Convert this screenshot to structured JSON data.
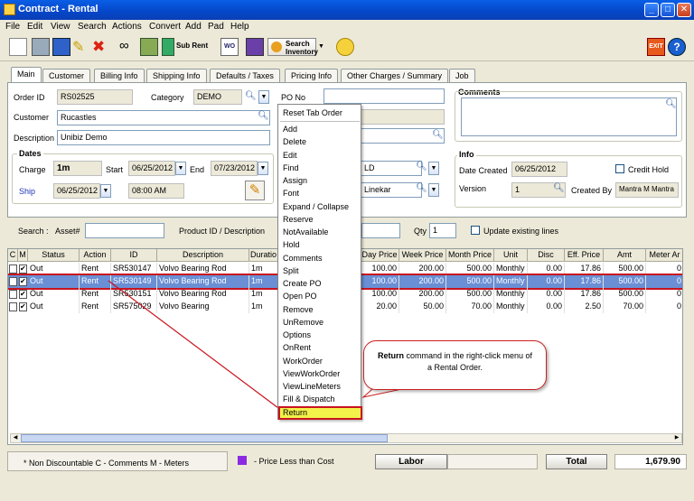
{
  "window": {
    "title": "Contract - Rental"
  },
  "menu": [
    "File",
    "Edit",
    "View",
    "Search",
    "Actions",
    "Convert",
    "Add",
    "Pad",
    "Help"
  ],
  "toolbar": {
    "subrent": "Sub Rent",
    "wo": "WO",
    "search_inv_1": "Search",
    "search_inv_2": "Inventory",
    "exit": "EXIT"
  },
  "tabs": [
    "Main",
    "Customer",
    "Billing Info",
    "Shipping Info",
    "Defaults / Taxes",
    "Pricing Info",
    "Other Charges / Summary",
    "Job"
  ],
  "form": {
    "order_id_label": "Order ID",
    "order_id": "RS02525",
    "category_label": "Category",
    "category": "DEMO",
    "po_no_label": "PO No",
    "customer_label": "Customer",
    "customer": "Rucastles",
    "description_label": "Description",
    "description": "Unibiz Demo",
    "dates_label": "Dates",
    "charge_label": "Charge",
    "charge": "1m",
    "start_label": "Start",
    "start": "06/25/2012",
    "end_label": "End",
    "end": "07/23/2012",
    "ship_label": "Ship",
    "ship_date": "06/25/2012",
    "ship_time": "08:00 AM",
    "field_ld": "LD",
    "field_linekar": "Linekar",
    "comments_label": "Comments",
    "info_label": "Info",
    "date_created_label": "Date Created",
    "date_created": "06/25/2012",
    "credit_hold_label": "Credit Hold",
    "version_label": "Version",
    "version": "1",
    "created_by_label": "Created By",
    "created_by": "Mantra M Mantra"
  },
  "search": {
    "search_label": "Search :",
    "asset_label": "Asset#",
    "product_label": "Product ID / Description",
    "qty_label": "Qty",
    "qty": "1",
    "update_label": "Update existing lines"
  },
  "grid": {
    "headers": [
      "C",
      "M",
      "Status",
      "Action",
      "ID",
      "Description",
      "Duratio",
      "Day Price",
      "Week Price",
      "Month Price",
      "Unit",
      "Disc",
      "Eff. Price",
      "Amt",
      "Meter Ar"
    ],
    "rows": [
      [
        "",
        "✔",
        "Out",
        "Rent",
        "SR530147",
        "Volvo Bearing Rod",
        "1m",
        "100.00",
        "200.00",
        "500.00",
        "Monthly",
        "0.00",
        "17.86",
        "500.00",
        "0"
      ],
      [
        "",
        "✔",
        "Out",
        "Rent",
        "SR530149",
        "Volvo Bearing Rod",
        "1m",
        "100.00",
        "200.00",
        "500.00",
        "Monthly",
        "0.00",
        "17.86",
        "500.00",
        "0"
      ],
      [
        "",
        "✔",
        "Out",
        "Rent",
        "SR530151",
        "Volvo Bearing Rod",
        "1m",
        "100.00",
        "200.00",
        "500.00",
        "Monthly",
        "0.00",
        "17.86",
        "500.00",
        "0"
      ],
      [
        "",
        "✔",
        "Out",
        "Rent",
        "SR575029",
        "Volvo Bearing",
        "1m",
        "20.00",
        "50.00",
        "70.00",
        "Monthly",
        "0.00",
        "2.50",
        "70.00",
        "0"
      ]
    ]
  },
  "context_menu": {
    "header": "Reset Tab Order",
    "items": [
      "Add",
      "Delete",
      "Edit",
      "Find",
      "Assign",
      "Font",
      "Expand / Collapse",
      "Reserve",
      "NotAvailable",
      "Hold",
      "Comments",
      "Split",
      "Create PO",
      "Open PO",
      "Remove",
      "UnRemove",
      "Options",
      "OnRent",
      "WorkOrder",
      "ViewWorkOrder",
      "ViewLineMeters",
      "Fill & Dispatch",
      "Return"
    ]
  },
  "callout": {
    "bold": "Return",
    "text": " command in the right-click menu of a Rental Order."
  },
  "status": {
    "legend": "* Non Discountable   C - Comments   M - Meters",
    "price_less": "- Price Less than Cost",
    "labor": "Labor",
    "total": "Total",
    "total_value": "1,679.90"
  },
  "colors": {
    "accent": "#0a5ee6",
    "highlight": "#f2f24b",
    "callout_border": "#cc2020",
    "selected_row": "#6a8fd4",
    "price_legend": "#8a2be2"
  }
}
